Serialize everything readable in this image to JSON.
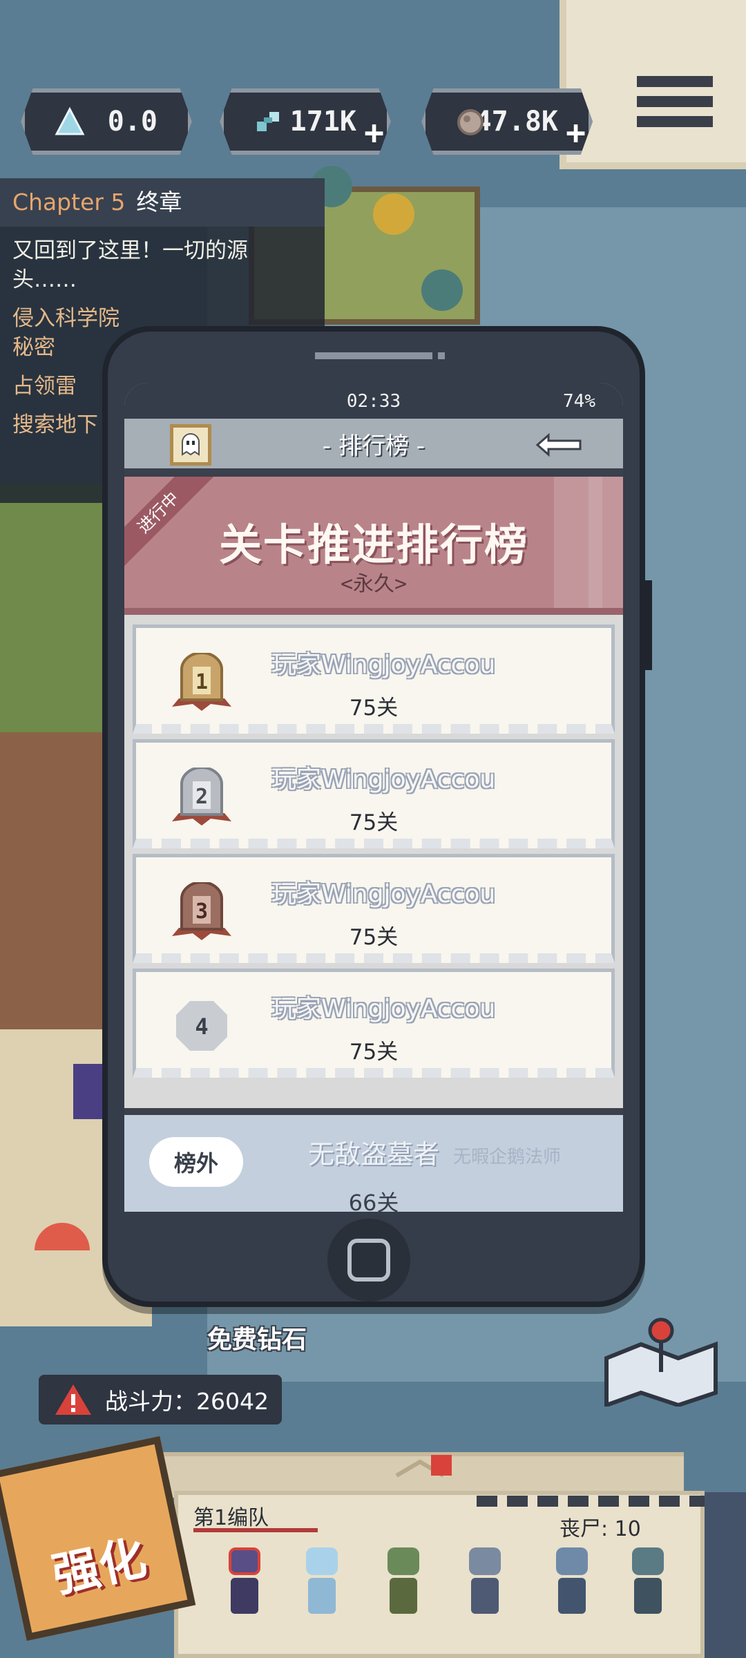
{
  "resources": {
    "diamond": {
      "value": "0.0",
      "icon": "diamond-icon"
    },
    "gene": {
      "value": "171K",
      "icon": "dna-icon"
    },
    "ore": {
      "value": "47.8K",
      "icon": "ore-icon"
    }
  },
  "quest": {
    "chapter_label": "Chapter 5",
    "chapter_name": "终章",
    "lines": [
      "又回到了这里！一切的源头……",
      "侵入科学院",
      "秘密",
      "占领雷",
      "搜索地下"
    ]
  },
  "phone": {
    "time": "02:33",
    "battery": "74%",
    "title": "- 排行榜 -",
    "banner": {
      "ribbon": "进行中",
      "title": "关卡推进排行榜",
      "subtitle": "<永久>"
    },
    "rankings": [
      {
        "rank": "1",
        "name": "玩家WingjoyAccou",
        "score": "75关"
      },
      {
        "rank": "2",
        "name": "玩家WingjoyAccou",
        "score": "75关"
      },
      {
        "rank": "3",
        "name": "玩家WingjoyAccou",
        "score": "75关"
      },
      {
        "rank": "4",
        "name": "玩家WingjoyAccou",
        "score": "75关"
      }
    ],
    "self": {
      "tag": "榜外",
      "name": "无敌盗墓者",
      "title": "无暇企鹅法师",
      "score": "66关"
    }
  },
  "hud": {
    "free_diamond": "免费钻石",
    "power": "战斗力：26042",
    "team_name": "第1编队",
    "zombie_count": "丧尸: 10",
    "upgrade": "强化"
  },
  "colors": {
    "gold": "#c9a46a",
    "silver": "#b8bcc2",
    "bronze": "#9b6e62",
    "accent_red": "#b23a3a"
  }
}
